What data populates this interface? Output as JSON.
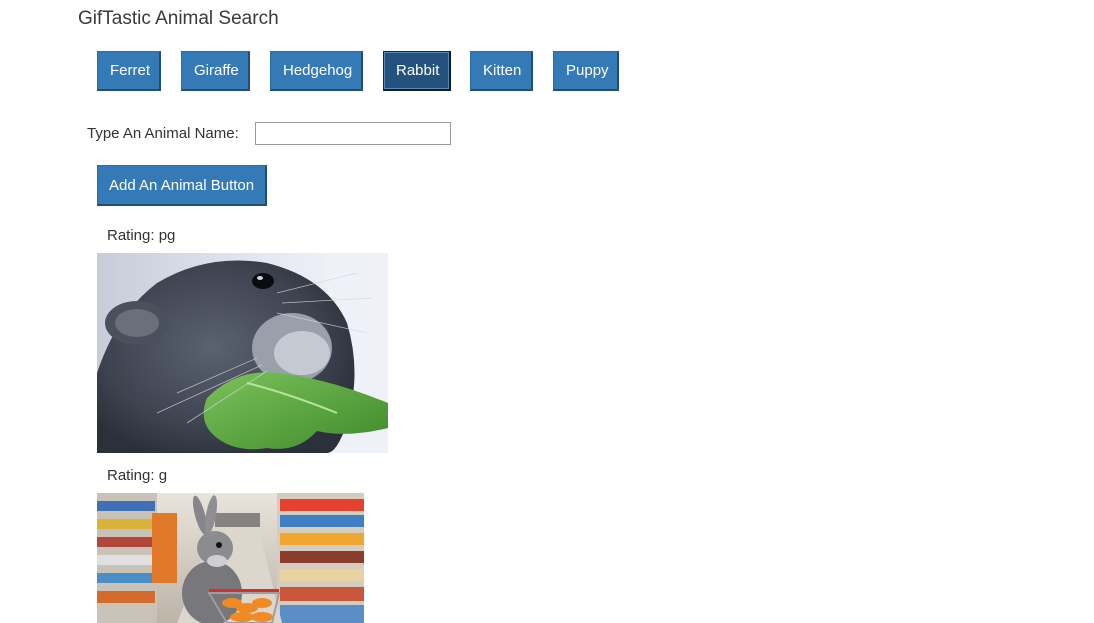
{
  "page": {
    "title": "GifTastic Animal Search"
  },
  "animal_buttons": [
    {
      "label": "Ferret",
      "active": false
    },
    {
      "label": "Giraffe",
      "active": false
    },
    {
      "label": "Hedgehog",
      "active": false
    },
    {
      "label": "Rabbit",
      "active": true
    },
    {
      "label": "Kitten",
      "active": false
    },
    {
      "label": "Puppy",
      "active": false
    }
  ],
  "form": {
    "label": "Type An Animal Name:",
    "input_value": "",
    "input_placeholder": "",
    "add_button_label": "Add An Animal Button"
  },
  "results": [
    {
      "rating_text": "Rating: pg",
      "image_subject": "rabbit-eating-lettuce"
    },
    {
      "rating_text": "Rating: g",
      "image_subject": "rabbit-pushing-shopping-cart"
    }
  ],
  "colors": {
    "button_blue": "#337ab7",
    "button_active": "#23527c",
    "text": "#333333"
  }
}
